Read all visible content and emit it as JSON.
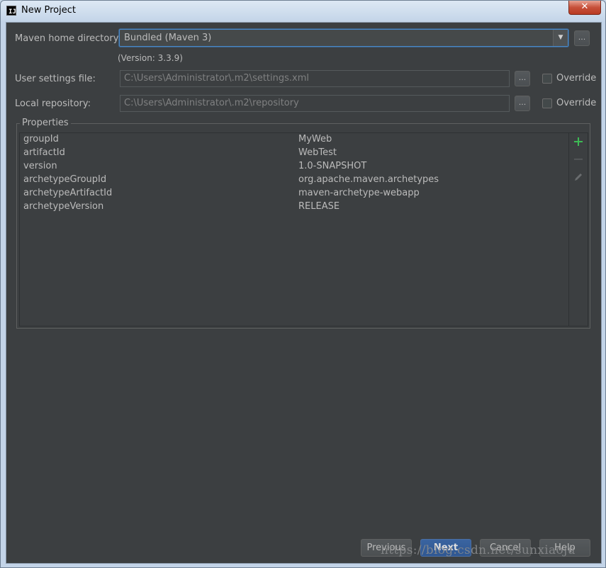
{
  "window": {
    "title": "New Project",
    "app_icon_glyph": "IJ",
    "close_glyph": "✕"
  },
  "maven_home": {
    "label": "Maven home directory:",
    "value": "Bundled (Maven 3)",
    "version": "(Version: 3.3.9)",
    "browse_label": "..."
  },
  "user_settings": {
    "label": "User settings file:",
    "value": "C:\\Users\\Administrator\\.m2\\settings.xml",
    "browse_label": "...",
    "override_label": "Override",
    "override_checked": false
  },
  "local_repo": {
    "label": "Local repository:",
    "value": "C:\\Users\\Administrator\\.m2\\repository",
    "browse_label": "...",
    "override_label": "Override",
    "override_checked": false
  },
  "properties": {
    "title": "Properties",
    "rows": [
      {
        "key": "groupId",
        "value": "MyWeb"
      },
      {
        "key": "artifactId",
        "value": "WebTest"
      },
      {
        "key": "version",
        "value": "1.0-SNAPSHOT"
      },
      {
        "key": "archetypeGroupId",
        "value": "org.apache.maven.archetypes"
      },
      {
        "key": "archetypeArtifactId",
        "value": "maven-archetype-webapp"
      },
      {
        "key": "archetypeVersion",
        "value": "RELEASE"
      }
    ],
    "tools": {
      "add_icon": "plus-icon",
      "remove_icon": "minus-icon",
      "edit_icon": "pencil-icon",
      "add_color": "#3dbb54"
    }
  },
  "buttons": {
    "previous": "Previous",
    "next": "Next",
    "cancel": "Cancel",
    "help": "Help"
  },
  "watermark": "https://blog.csdn.net/sunxiaoju",
  "colors": {
    "panel_bg": "#3c3f41",
    "accent": "#4a88c7",
    "primary_button": "#365f99"
  }
}
